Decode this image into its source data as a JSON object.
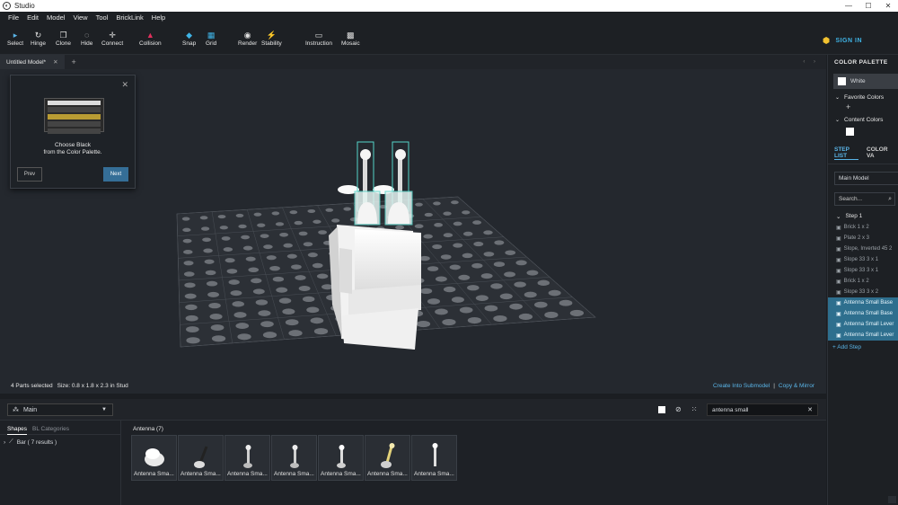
{
  "window": {
    "title": "Studio",
    "controls": [
      "—",
      "☐",
      "✕"
    ]
  },
  "menu": [
    "File",
    "Edit",
    "Model",
    "View",
    "Tool",
    "BrickLink",
    "Help"
  ],
  "toolbar": [
    {
      "label": "Select",
      "icon": "▸"
    },
    {
      "label": "Hinge",
      "icon": "↻"
    },
    {
      "label": "Clone",
      "icon": "❐"
    },
    {
      "label": "Hide",
      "icon": "◌"
    },
    {
      "label": "Connect",
      "icon": "✛"
    },
    {
      "label": "Collision",
      "icon": "▲"
    },
    {
      "label": "Snap",
      "icon": "◆"
    },
    {
      "label": "Grid",
      "icon": "▦"
    },
    {
      "label": "Render",
      "icon": "◉"
    },
    {
      "label": "Stability",
      "icon": "⚡"
    },
    {
      "label": "Instruction",
      "icon": "▭"
    },
    {
      "label": "Mosaic",
      "icon": "▩"
    }
  ],
  "signin": "SIGN IN",
  "tabs": {
    "active": "Untitled Model*",
    "close": "✕",
    "add": "+",
    "nav": "‹ ›"
  },
  "guide": {
    "close": "✕",
    "message_line1": "Choose Black",
    "message_line2": "from the Color Palette.",
    "prev": "Prev",
    "next": "Next",
    "thumb_rows": [
      "Type color...",
      "All",
      "Black",
      "Light Bluish Gray",
      "Light Gray"
    ]
  },
  "status": {
    "selection": "4 Parts selected",
    "size": "Size: 0.8 x 1.8 x 2.3 in Stud",
    "create_submodel": "Create Into Submodel",
    "separator": "|",
    "copy_mirror": "Copy & Mirror"
  },
  "library": {
    "dropdown": "Main",
    "search_value": "antenna small",
    "tabs": [
      "Shapes",
      "BL Categories"
    ],
    "category": "Bar ( 7 results )",
    "group_header": "Antenna (7)",
    "parts": [
      "Antenna Sma...",
      "Antenna Sma...",
      "Antenna Sma...",
      "Antenna Sma...",
      "Antenna Sma...",
      "Antenna Sma...",
      "Antenna Sma..."
    ]
  },
  "right_panel": {
    "header": "COLOR PALETTE",
    "selected_color": "White",
    "favorite_colors": "Favorite Colors",
    "content_colors": "Content Colors",
    "tab_steps": "STEP LIST",
    "tab_colors": "COLOR VA",
    "main_model": "Main Model",
    "search_placeholder": "Search...",
    "step": "Step 1",
    "steps": [
      {
        "name": "Brick 1 x 2",
        "selected": false
      },
      {
        "name": "Plate 2 x 3",
        "selected": false
      },
      {
        "name": "Slope, Inverted 45 2",
        "selected": false
      },
      {
        "name": "Slope 33 3 x 1",
        "selected": false
      },
      {
        "name": "Slope 33 3 x 1",
        "selected": false
      },
      {
        "name": "Brick 1 x 2",
        "selected": false
      },
      {
        "name": "Slope 33 3 x 2",
        "selected": false
      },
      {
        "name": "Antenna Small Base",
        "selected": true
      },
      {
        "name": "Antenna Small Base",
        "selected": true
      },
      {
        "name": "Antenna Small Lever",
        "selected": true
      },
      {
        "name": "Antenna Small Lever",
        "selected": true
      }
    ],
    "add_step": "+ Add Step"
  },
  "colors": {
    "accent": "#5ab5e8",
    "selection": "#2e6f8e",
    "next_button": "#356e97"
  }
}
